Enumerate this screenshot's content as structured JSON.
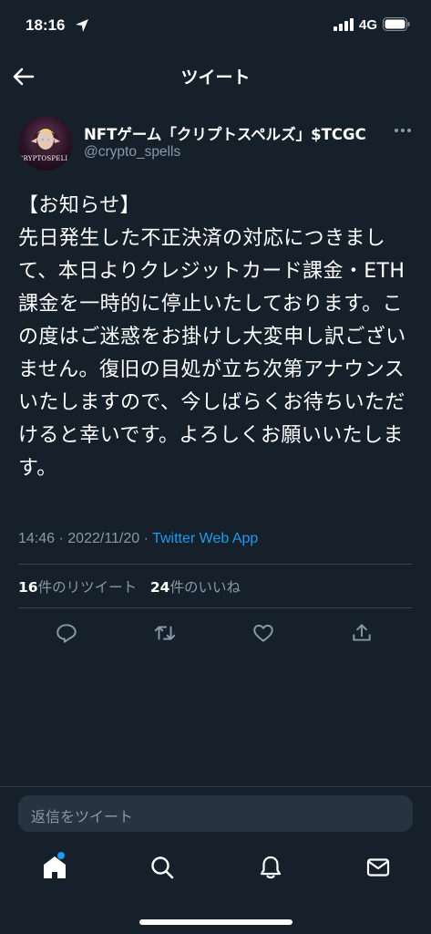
{
  "status_bar": {
    "time": "18:16",
    "network": "4G"
  },
  "nav": {
    "title": "ツイート"
  },
  "tweet": {
    "avatar_logo": "CRYPTOSPELLS",
    "display_name": "NFTゲーム「クリプトスペルズ」$TCGC",
    "handle": "@crypto_spells",
    "text": "【お知らせ】\n先日発生した不正決済の対応につきまして、本日よりクレジットカード課金・ETH課金を一時的に停止いたしております。この度はご迷惑をお掛けし大変申し訳ございません。復旧の目処が立ち次第アナウンスいたしますので、今しばらくお待ちいただけると幸いです。よろしくお願いいたします。",
    "time": "14:46",
    "date": "2022/11/20",
    "source": "Twitter Web App",
    "retweets": "16",
    "retweets_label": "件のリツイート",
    "likes": "24",
    "likes_label": "件のいいね"
  },
  "reply": {
    "placeholder": "返信をツイート"
  },
  "colors": {
    "background": "#15202b",
    "accent": "#1d9bf0",
    "muted": "#8b98a5"
  },
  "icons": {
    "actions": [
      "reply-icon",
      "retweet-icon",
      "like-icon",
      "share-icon"
    ],
    "tabs": [
      "home-icon",
      "search-icon",
      "notifications-icon",
      "messages-icon"
    ]
  }
}
